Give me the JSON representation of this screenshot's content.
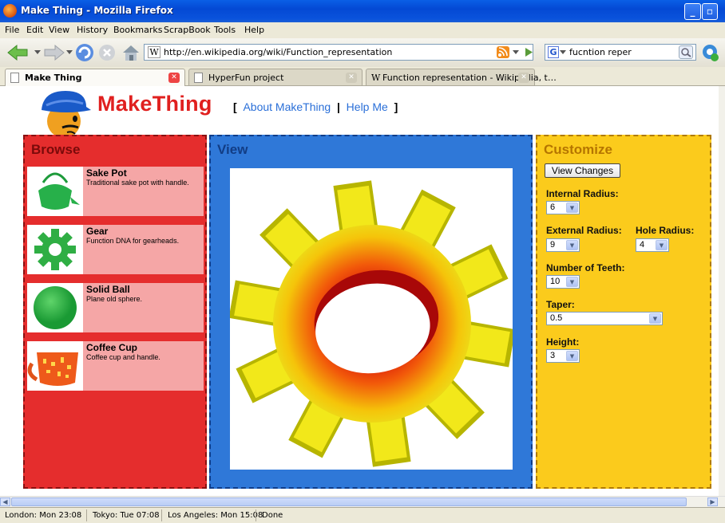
{
  "window": {
    "title": "Make Thing - Mozilla Firefox"
  },
  "menu": [
    "File",
    "Edit",
    "View",
    "History",
    "Bookmarks",
    "ScrapBook",
    "Tools",
    "Help"
  ],
  "nav": {
    "url": "http://en.wikipedia.org/wiki/Function_representation",
    "search_value": "fucntion reper"
  },
  "tabs": [
    {
      "label": "Make Thing",
      "active": true
    },
    {
      "label": "HyperFun project",
      "active": false
    },
    {
      "label": "Function representation - Wikipedia, t…",
      "active": false
    }
  ],
  "header": {
    "brand": "MakeThing",
    "open_bracket": "[",
    "about_link": "About MakeThing",
    "separator": "|",
    "help_link": "Help Me",
    "close_bracket": "]"
  },
  "browse": {
    "title": "Browse",
    "items": [
      {
        "name": "Sake Pot",
        "desc": "Traditional sake pot with handle."
      },
      {
        "name": "Gear",
        "desc": "Function DNA for gearheads."
      },
      {
        "name": "Solid Ball",
        "desc": "Plane old sphere."
      },
      {
        "name": "Coffee Cup",
        "desc": "Coffee cup and handle."
      }
    ]
  },
  "view": {
    "title": "View"
  },
  "customize": {
    "title": "Customize",
    "view_changes": "View Changes",
    "internal_radius": {
      "label": "Internal Radius:",
      "value": "6"
    },
    "external_radius": {
      "label": "External Radius:",
      "value": "9"
    },
    "hole_radius": {
      "label": "Hole Radius:",
      "value": "4"
    },
    "teeth": {
      "label": "Number of Teeth:",
      "value": "10"
    },
    "taper": {
      "label": "Taper:",
      "value": "0.5"
    },
    "height": {
      "label": "Height:",
      "value": "3"
    }
  },
  "status": {
    "london": "London: Mon 23:08",
    "tokyo": "Tokyo: Tue 07:08",
    "la": "Los Angeles: Mon 15:08",
    "state": "Done"
  },
  "colors": {
    "browse": "#e52d2d",
    "view": "#2f78d8",
    "customize": "#fbcb1c",
    "brand": "#e0201f",
    "link": "#2a6fd8"
  }
}
